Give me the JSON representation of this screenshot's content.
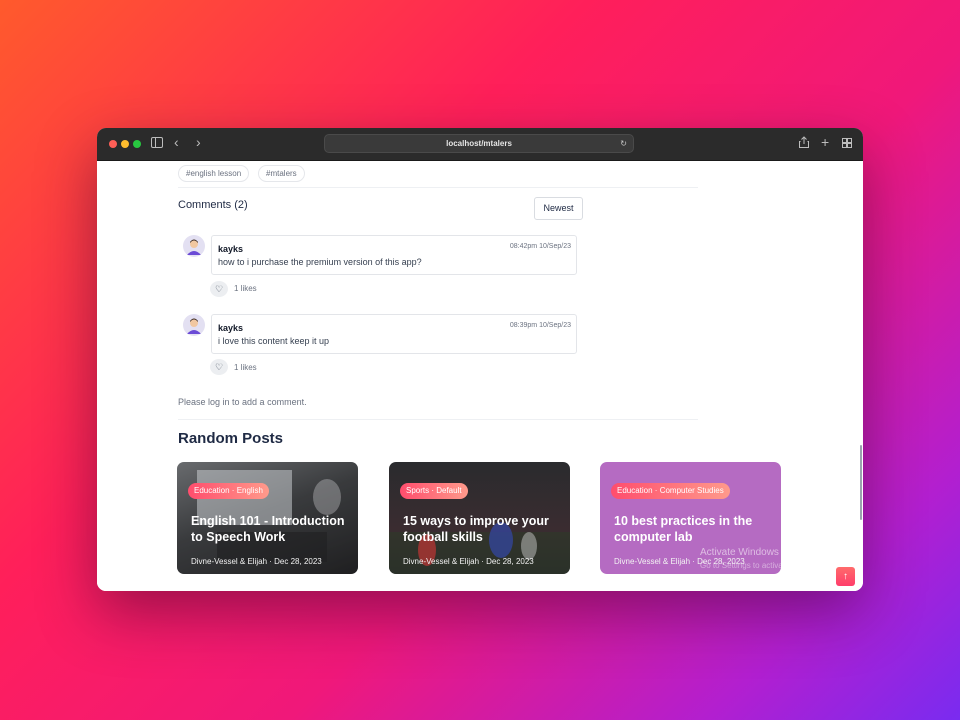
{
  "browser": {
    "url": "localhost/mtalers"
  },
  "tags": [
    "#english lesson",
    "#mtalers"
  ],
  "comments": {
    "heading": "Comments (2)",
    "sort_label": "Newest",
    "items": [
      {
        "author": "kayks",
        "time": "08:42pm 10/Sep/23",
        "body": "how to i purchase the premium version of this app?",
        "likes": "1 likes"
      },
      {
        "author": "kayks",
        "time": "08:39pm 10/Sep/23",
        "body": "i love this content keep it up",
        "likes": "1 likes"
      }
    ],
    "login_note": "Please log in to add a comment."
  },
  "random_posts": {
    "heading": "Random Posts",
    "cards": [
      {
        "badge": "Education · English",
        "title": "English 101 - Introduction to Speech Work",
        "meta": "Divne-Vessel & Elijah  ·  Dec 28, 2023"
      },
      {
        "badge": "Sports · Default",
        "title": "15 ways to improve your football skills",
        "meta": "Divne-Vessel & Elijah  ·  Dec 28, 2023"
      },
      {
        "badge": "Education · Computer Studies",
        "title": "10 best practices in the computer lab",
        "meta": "Divne-Vessel & Elijah  ·  Dec 28, 2023"
      }
    ]
  },
  "watermark": {
    "line1": "Activate Windows",
    "line2": "Go to Settings to activate Windows."
  },
  "colors": {
    "accent": "#ff4d6d",
    "card3_bg": "#b56bc2"
  }
}
